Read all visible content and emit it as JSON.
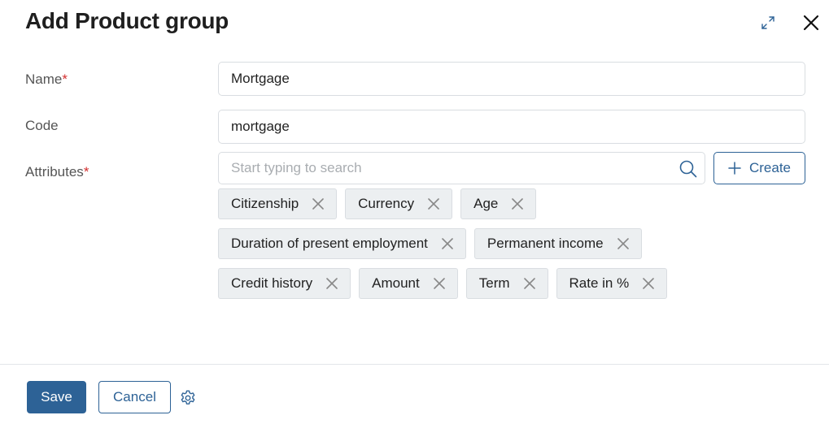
{
  "dialog": {
    "title": "Add Product group"
  },
  "form": {
    "name_label": "Name",
    "code_label": "Code",
    "attributes_label": "Attributes",
    "required_mark": "*",
    "name_value": "Mortgage",
    "code_value": "mortgage",
    "search_placeholder": "Start typing to search",
    "create_label": "Create",
    "attribute_tags": [
      [
        "Citizenship",
        "Currency",
        "Age"
      ],
      [
        "Duration of present employment",
        "Permanent income"
      ],
      [
        "Credit history",
        "Amount",
        "Term",
        "Rate in %"
      ]
    ]
  },
  "footer": {
    "save_label": "Save",
    "cancel_label": "Cancel"
  },
  "icons": {
    "expand": "expand-icon",
    "close": "close-icon",
    "search": "search-icon",
    "plus": "plus-icon",
    "remove": "x-icon",
    "settings": "gear-icon"
  },
  "colors": {
    "primary": "#2d6296",
    "required": "#d32f2f",
    "tag_bg": "#eceff1"
  }
}
